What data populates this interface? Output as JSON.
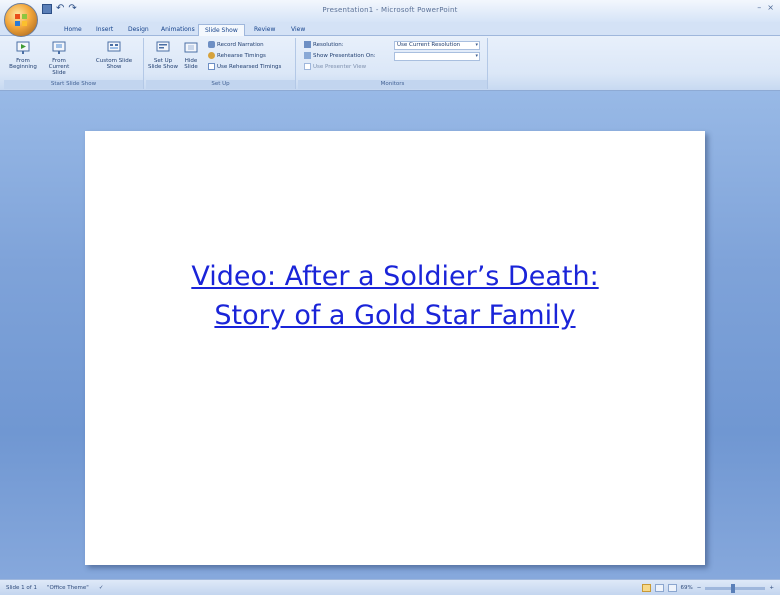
{
  "window": {
    "title": "Presentation1 - Microsoft PowerPoint",
    "controls": [
      "–",
      "×"
    ]
  },
  "tabs": [
    "Home",
    "Insert",
    "Design",
    "Animations",
    "Slide Show",
    "Review",
    "View"
  ],
  "active_tab": "Slide Show",
  "ribbon": {
    "start_group": {
      "label": "Start Slide Show",
      "from_beginning": "From Beginning",
      "from_current": "From Current Slide",
      "custom": "Custom Slide Show"
    },
    "setup_group": {
      "label": "Set Up",
      "setup_show": "Set Up Slide Show",
      "hide_slide": "Hide Slide",
      "record_narration": "Record Narration",
      "rehearse": "Rehearse Timings",
      "use_rehearsed": "Use Rehearsed Timings"
    },
    "monitors_group": {
      "label": "Monitors",
      "resolution": "Resolution:",
      "resolution_value": "Use Current Resolution",
      "show_on": "Show Presentation On:",
      "show_on_value": "",
      "presenter_view": "Use Presenter View"
    }
  },
  "slide": {
    "line1": "Video: After a Soldier’s Death:",
    "line2": "Story of a Gold Star Family"
  },
  "statusbar": {
    "slide_count": "Slide 1 of 1",
    "theme": "\"Office Theme\"",
    "zoom": "69%"
  },
  "colors": {
    "link": "#1a24d8",
    "workspace": "#7fa3d9",
    "ribbon": "#dbe7f7"
  }
}
